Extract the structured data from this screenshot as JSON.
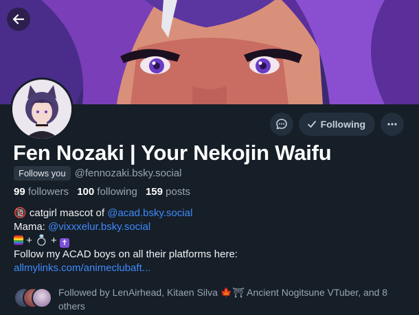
{
  "profile": {
    "display_name": "Fen Nozaki | Your Nekojin Waifu",
    "follows_you_badge": "Follows you",
    "handle": "@fennozaki.bsky.social"
  },
  "stats": {
    "followers_count": "99",
    "followers_label": "followers",
    "following_count": "100",
    "following_label": "following",
    "posts_count": "159",
    "posts_label": "posts"
  },
  "actions": {
    "following_label": "Following"
  },
  "bio": {
    "line1_emoji": "🔞",
    "line1_text": " catgirl mascot of ",
    "line1_link": "@acad.bsky.social",
    "line2_text": "Mama: ",
    "line2_link": "@vixxxelur.bsky.social",
    "line3_plus1": " + ",
    "line3_ring": "💍",
    "line3_plus2": " + ",
    "line3_cross": "✝",
    "line4_text": "Follow my ACAD boys on all their platforms here:",
    "line5_link": "allmylinks.com/animeclubaft..."
  },
  "followed_by": {
    "text": "Followed by LenAirhead, Kitaen Silva 🍁⛩ Ancient Nogitsune VTuber, and 8 others"
  },
  "icons": {
    "back": "arrow-left-icon",
    "message": "chat-bubble-icon",
    "check": "check-icon",
    "more": "ellipsis-icon"
  },
  "colors": {
    "background": "#161e27",
    "link": "#3f8bff",
    "muted": "#9aa6b4",
    "button_bg": "#232f3c"
  }
}
